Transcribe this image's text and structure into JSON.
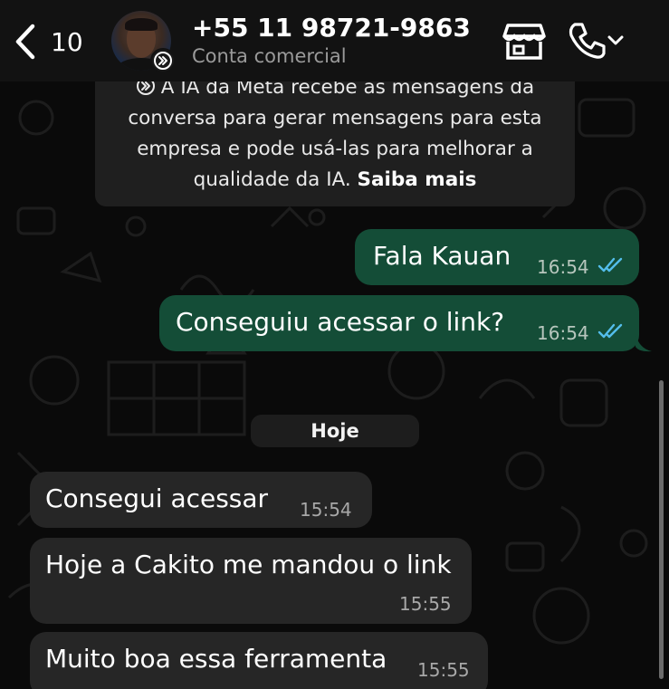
{
  "header": {
    "back_count": "10",
    "contact_name": "+55 11 98721-9863",
    "contact_subtitle": "Conta comercial"
  },
  "notice": {
    "text": "A IA da Meta recebe as mensagens da conversa para gerar mensagens para esta empresa e pode usá-las para melhorar a qualidade da IA.",
    "link": "Saiba mais"
  },
  "messages_before": [
    {
      "text": "Fala Kauan",
      "time": "16:54",
      "direction": "outgoing",
      "status": "read"
    },
    {
      "text": "Conseguiu acessar o link?",
      "time": "16:54",
      "direction": "outgoing",
      "status": "read"
    }
  ],
  "day_separator": "Hoje",
  "messages_today": [
    {
      "text": "Consegui acessar",
      "time": "15:54",
      "direction": "incoming"
    },
    {
      "text": "Hoje a Cakito me mandou o link",
      "time": "15:55",
      "direction": "incoming"
    },
    {
      "text": "Muito boa essa ferramenta",
      "time": "15:55",
      "direction": "incoming"
    }
  ],
  "colors": {
    "outgoing_bubble": "#144d37",
    "incoming_bubble": "#262626",
    "read_ticks": "#53bdeb",
    "background": "#0a0a0a"
  },
  "icons": [
    "chevron-left-icon",
    "meta-ai-icon",
    "store-icon",
    "phone-icon",
    "chevron-down-icon",
    "double-check-icon"
  ]
}
